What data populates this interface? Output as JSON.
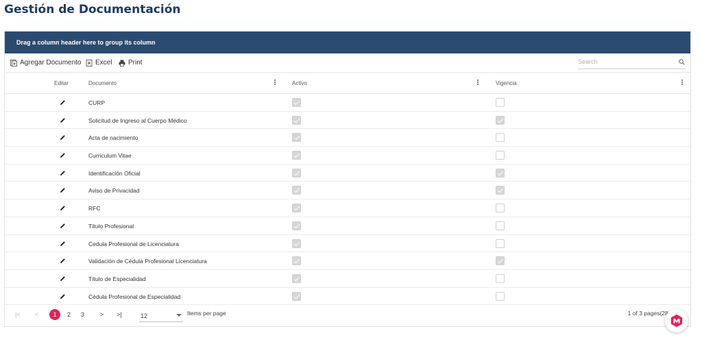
{
  "page": {
    "title": "Gestión de Documentación"
  },
  "grid": {
    "group_panel_text": "Drag a column header here to group its column",
    "toolbar": {
      "add_label": "Agregar Documento",
      "excel_label": "Excel",
      "print_label": "Print",
      "search_placeholder": "Search"
    },
    "columns": {
      "editar": "Editar",
      "documento": "Documento",
      "activo": "Activo",
      "vigencia": "Vigencia"
    },
    "rows": [
      {
        "documento": "CURP",
        "activo": true,
        "vigencia": false
      },
      {
        "documento": "Solicitud de Ingreso al Cuerpo Médico",
        "activo": true,
        "vigencia": true
      },
      {
        "documento": "Acta de nacimiento",
        "activo": true,
        "vigencia": false
      },
      {
        "documento": "Curriculum Vitae",
        "activo": true,
        "vigencia": false
      },
      {
        "documento": "Identificación Oficial",
        "activo": true,
        "vigencia": true
      },
      {
        "documento": "Aviso de Privacidad",
        "activo": true,
        "vigencia": true
      },
      {
        "documento": "RFC",
        "activo": true,
        "vigencia": false
      },
      {
        "documento": "Título Profesional",
        "activo": true,
        "vigencia": false
      },
      {
        "documento": "Cedula Profesional de Licenciatura",
        "activo": true,
        "vigencia": false
      },
      {
        "documento": "Validación de Cédula Profesional Licenciatura",
        "activo": true,
        "vigencia": true
      },
      {
        "documento": "Título de Especialidad",
        "activo": true,
        "vigencia": false
      },
      {
        "documento": "Cédula Profesional de Especialidad",
        "activo": true,
        "vigencia": false
      }
    ],
    "pager": {
      "first": "|<",
      "prev": "<",
      "pages": [
        "1",
        "2",
        "3"
      ],
      "current_page": "1",
      "next": ">",
      "last": ">|",
      "page_size": "12",
      "items_per_page_label": "Items per page",
      "info": "1 of 3 pages(28 i"
    }
  },
  "colors": {
    "title": "#1f3a5f",
    "group_panel_bg": "#2b4a6f",
    "pager_accent": "#e0245e",
    "fab_accent": "#e0245e"
  },
  "icons": {
    "add": "add-document-icon",
    "excel": "excel-icon",
    "print": "print-icon",
    "search": "search-icon",
    "edit": "pencil-icon",
    "fab": "logo-badge-icon"
  }
}
